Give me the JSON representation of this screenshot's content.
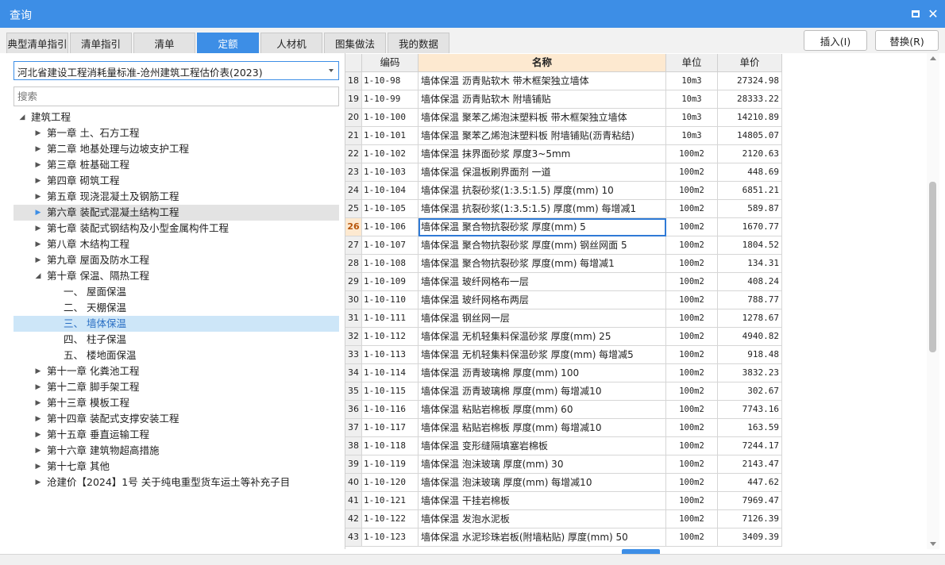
{
  "window": {
    "title": "查询"
  },
  "tabs": [
    "典型清单指引",
    "清单指引",
    "清单",
    "定额",
    "人材机",
    "图集做法",
    "我的数据"
  ],
  "actions": {
    "insert": "插入(I)",
    "replace": "替换(R)"
  },
  "left": {
    "selected_library": "河北省建设工程消耗量标准-沧州建筑工程估价表(2023)",
    "search_placeholder": "搜索",
    "tree": [
      {
        "label": "建筑工程",
        "level": 0,
        "state": "expanded"
      },
      {
        "label": "第一章 土、石方工程",
        "level": 1,
        "state": "collapsed"
      },
      {
        "label": "第二章 地基处理与边坡支护工程",
        "level": 1,
        "state": "collapsed"
      },
      {
        "label": "第三章 桩基础工程",
        "level": 1,
        "state": "collapsed"
      },
      {
        "label": "第四章 砌筑工程",
        "level": 1,
        "state": "collapsed"
      },
      {
        "label": "第五章 现浇混凝土及钢筋工程",
        "level": 1,
        "state": "collapsed"
      },
      {
        "label": "第六章 装配式混凝土结构工程",
        "level": 1,
        "state": "collapsed",
        "hover": true
      },
      {
        "label": "第七章 装配式钢结构及小型金属构件工程",
        "level": 1,
        "state": "collapsed"
      },
      {
        "label": "第八章 木结构工程",
        "level": 1,
        "state": "collapsed"
      },
      {
        "label": "第九章 屋面及防水工程",
        "level": 1,
        "state": "collapsed"
      },
      {
        "label": "第十章 保温、隔热工程",
        "level": 1,
        "state": "expanded"
      },
      {
        "label": "一、 屋面保温",
        "level": 2,
        "state": "leaf"
      },
      {
        "label": "二、 天棚保温",
        "level": 2,
        "state": "leaf"
      },
      {
        "label": "三、 墙体保温",
        "level": 2,
        "state": "leaf",
        "selected": true
      },
      {
        "label": "四、 柱子保温",
        "level": 2,
        "state": "leaf"
      },
      {
        "label": "五、 楼地面保温",
        "level": 2,
        "state": "leaf"
      },
      {
        "label": "第十一章 化粪池工程",
        "level": 1,
        "state": "collapsed"
      },
      {
        "label": "第十二章 脚手架工程",
        "level": 1,
        "state": "collapsed"
      },
      {
        "label": "第十三章 模板工程",
        "level": 1,
        "state": "collapsed"
      },
      {
        "label": "第十四章 装配式支撑安装工程",
        "level": 1,
        "state": "collapsed"
      },
      {
        "label": "第十五章 垂直运输工程",
        "level": 1,
        "state": "collapsed"
      },
      {
        "label": "第十六章 建筑物超高措施",
        "level": 1,
        "state": "collapsed"
      },
      {
        "label": "第十七章 其他",
        "level": 1,
        "state": "collapsed"
      },
      {
        "label": "沧建价【2024】1号 关于纯电重型货车运土等补充子目",
        "level": 1,
        "state": "collapsed"
      }
    ]
  },
  "grid": {
    "columns": [
      "编码",
      "名称",
      "单位",
      "单价"
    ],
    "current_row": "26",
    "rows": [
      {
        "no": "18",
        "code": "1-10-98",
        "name": "墙体保温 沥青贴软木 带木框架独立墙体",
        "unit": "10m3",
        "price": "27324.98"
      },
      {
        "no": "19",
        "code": "1-10-99",
        "name": "墙体保温 沥青贴软木 附墙铺贴",
        "unit": "10m3",
        "price": "28333.22"
      },
      {
        "no": "20",
        "code": "1-10-100",
        "name": "墙体保温 聚苯乙烯泡沫塑料板 带木框架独立墙体",
        "unit": "10m3",
        "price": "14210.89"
      },
      {
        "no": "21",
        "code": "1-10-101",
        "name": "墙体保温 聚苯乙烯泡沫塑料板 附墙铺贴(沥青粘结)",
        "unit": "10m3",
        "price": "14805.07"
      },
      {
        "no": "22",
        "code": "1-10-102",
        "name": "墙体保温 抹界面砂浆 厚度3~5mm",
        "unit": "100m2",
        "price": "2120.63"
      },
      {
        "no": "23",
        "code": "1-10-103",
        "name": "墙体保温 保温板刷界面剂 一道",
        "unit": "100m2",
        "price": "448.69"
      },
      {
        "no": "24",
        "code": "1-10-104",
        "name": "墙体保温 抗裂砂浆(1:3.5:1.5) 厚度(mm) 10",
        "unit": "100m2",
        "price": "6851.21"
      },
      {
        "no": "25",
        "code": "1-10-105",
        "name": "墙体保温 抗裂砂浆(1:3.5:1.5) 厚度(mm) 每增减1",
        "unit": "100m2",
        "price": "589.87"
      },
      {
        "no": "26",
        "code": "1-10-106",
        "name": "墙体保温 聚合物抗裂砂浆 厚度(mm) 5",
        "unit": "100m2",
        "price": "1670.77"
      },
      {
        "no": "27",
        "code": "1-10-107",
        "name": "墙体保温 聚合物抗裂砂浆 厚度(mm) 钢丝网面 5",
        "unit": "100m2",
        "price": "1804.52"
      },
      {
        "no": "28",
        "code": "1-10-108",
        "name": "墙体保温 聚合物抗裂砂浆 厚度(mm) 每增减1",
        "unit": "100m2",
        "price": "134.31"
      },
      {
        "no": "29",
        "code": "1-10-109",
        "name": "墙体保温 玻纤网格布一层",
        "unit": "100m2",
        "price": "408.24"
      },
      {
        "no": "30",
        "code": "1-10-110",
        "name": "墙体保温 玻纤网格布两层",
        "unit": "100m2",
        "price": "788.77"
      },
      {
        "no": "31",
        "code": "1-10-111",
        "name": "墙体保温 钢丝网一层",
        "unit": "100m2",
        "price": "1278.67"
      },
      {
        "no": "32",
        "code": "1-10-112",
        "name": "墙体保温 无机轻集料保温砂浆 厚度(mm) 25",
        "unit": "100m2",
        "price": "4940.82"
      },
      {
        "no": "33",
        "code": "1-10-113",
        "name": "墙体保温 无机轻集料保温砂浆 厚度(mm) 每增减5",
        "unit": "100m2",
        "price": "918.48"
      },
      {
        "no": "34",
        "code": "1-10-114",
        "name": "墙体保温 沥青玻璃棉 厚度(mm) 100",
        "unit": "100m2",
        "price": "3832.23"
      },
      {
        "no": "35",
        "code": "1-10-115",
        "name": "墙体保温 沥青玻璃棉 厚度(mm) 每增减10",
        "unit": "100m2",
        "price": "302.67"
      },
      {
        "no": "36",
        "code": "1-10-116",
        "name": "墙体保温 粘贴岩棉板 厚度(mm) 60",
        "unit": "100m2",
        "price": "7743.16"
      },
      {
        "no": "37",
        "code": "1-10-117",
        "name": "墙体保温 粘贴岩棉板 厚度(mm) 每增减10",
        "unit": "100m2",
        "price": "163.59"
      },
      {
        "no": "38",
        "code": "1-10-118",
        "name": "墙体保温 变形缝隔填塞岩棉板",
        "unit": "100m2",
        "price": "7244.17"
      },
      {
        "no": "39",
        "code": "1-10-119",
        "name": "墙体保温 泡沫玻璃 厚度(mm) 30",
        "unit": "100m2",
        "price": "2143.47"
      },
      {
        "no": "40",
        "code": "1-10-120",
        "name": "墙体保温 泡沫玻璃 厚度(mm) 每增减10",
        "unit": "100m2",
        "price": "447.62"
      },
      {
        "no": "41",
        "code": "1-10-121",
        "name": "墙体保温 干挂岩棉板",
        "unit": "100m2",
        "price": "7969.47"
      },
      {
        "no": "42",
        "code": "1-10-122",
        "name": "墙体保温 发泡水泥板",
        "unit": "100m2",
        "price": "7126.39"
      },
      {
        "no": "43",
        "code": "1-10-123",
        "name": "墙体保温 水泥珍珠岩板(附墙粘贴) 厚度(mm) 50",
        "unit": "100m2",
        "price": "3409.39"
      }
    ]
  },
  "colors": {
    "accent": "#3d8ee6",
    "header_highlight": "#fde9d0",
    "selected_tree": "#cde6f8"
  }
}
